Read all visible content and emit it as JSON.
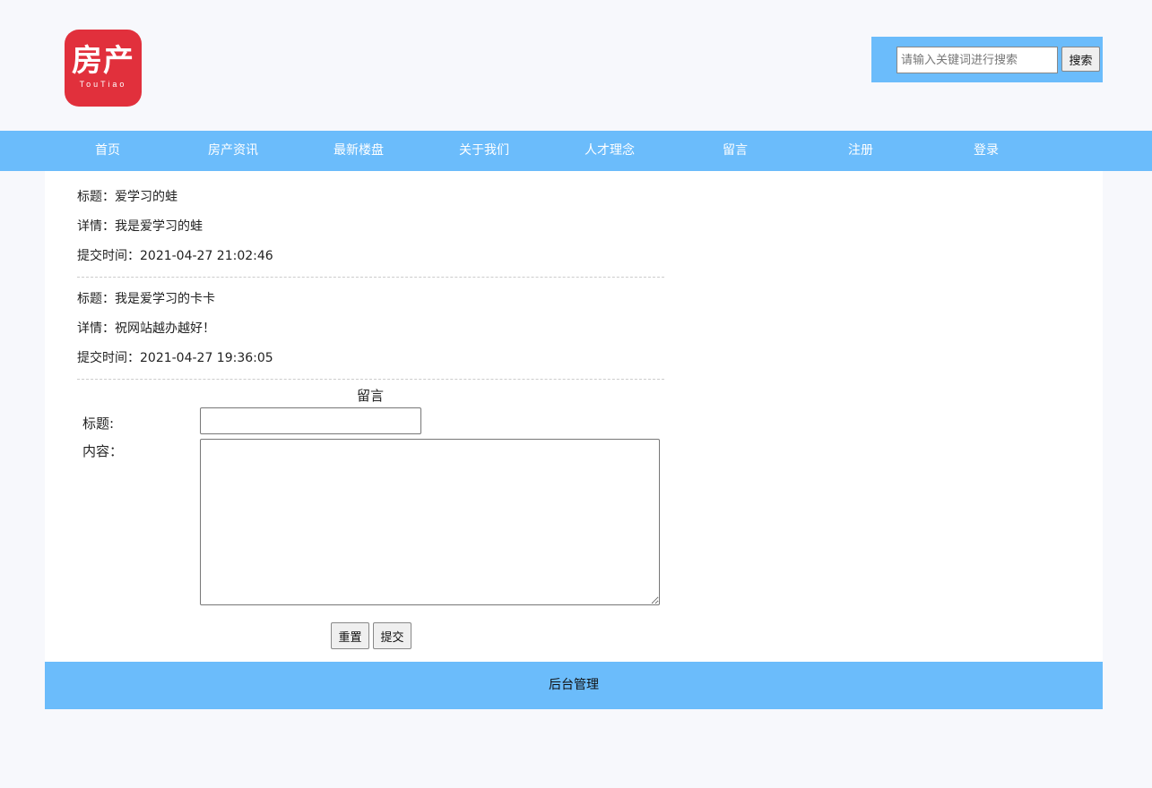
{
  "logo": {
    "cn": "房产",
    "en": "TouTiao"
  },
  "search": {
    "placeholder": "请输入关键词进行搜索",
    "button_label": "搜索"
  },
  "nav": [
    "首页",
    "房产资讯",
    "最新楼盘",
    "关于我们",
    "人才理念",
    "留言",
    "注册",
    "登录"
  ],
  "messages": [
    {
      "title_line": "标题：爱学习的蛙",
      "detail_line": "详情：我是爱学习的蛙",
      "time_line": "提交时间：2021-04-27 21:02:46"
    },
    {
      "title_line": "标题：我是爱学习的卡卡",
      "detail_line": "详情：祝网站越办越好！",
      "time_line": "提交时间：2021-04-27 19:36:05"
    }
  ],
  "form": {
    "heading": "留言",
    "title_label": "标题:",
    "content_label": "内容：",
    "reset_label": "重置",
    "submit_label": "提交"
  },
  "footer": {
    "admin_link": "后台管理"
  },
  "colors": {
    "accent": "#6bbcfb",
    "logo_red": "#e1303c",
    "page_bg": "#f7f8fc"
  }
}
